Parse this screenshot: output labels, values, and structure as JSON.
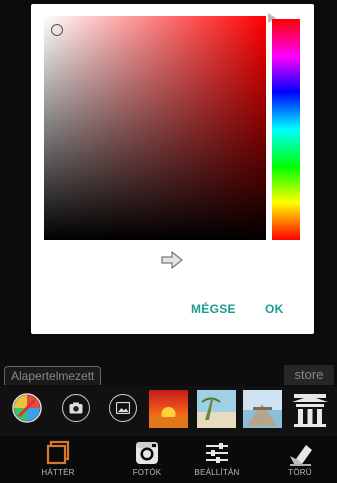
{
  "dialog": {
    "cancel_label": "MÉGSE",
    "ok_label": "OK"
  },
  "colors": {
    "accent": "#1a9c8c",
    "selected_hue": "#ff0000",
    "nav_active": "#d9772b"
  },
  "toolbar": {
    "tab_label": "Alapertelmezett",
    "store_label": "store"
  },
  "nav": {
    "items": [
      {
        "label": "HÁTTÉR",
        "icon": "background-icon"
      },
      {
        "label": "FOTÓK",
        "icon": "instagram-icon"
      },
      {
        "label": "BEÁLLÍTÁN",
        "icon": "sliders-icon"
      },
      {
        "label": "TÖRÜ",
        "icon": "eraser-icon"
      }
    ]
  }
}
